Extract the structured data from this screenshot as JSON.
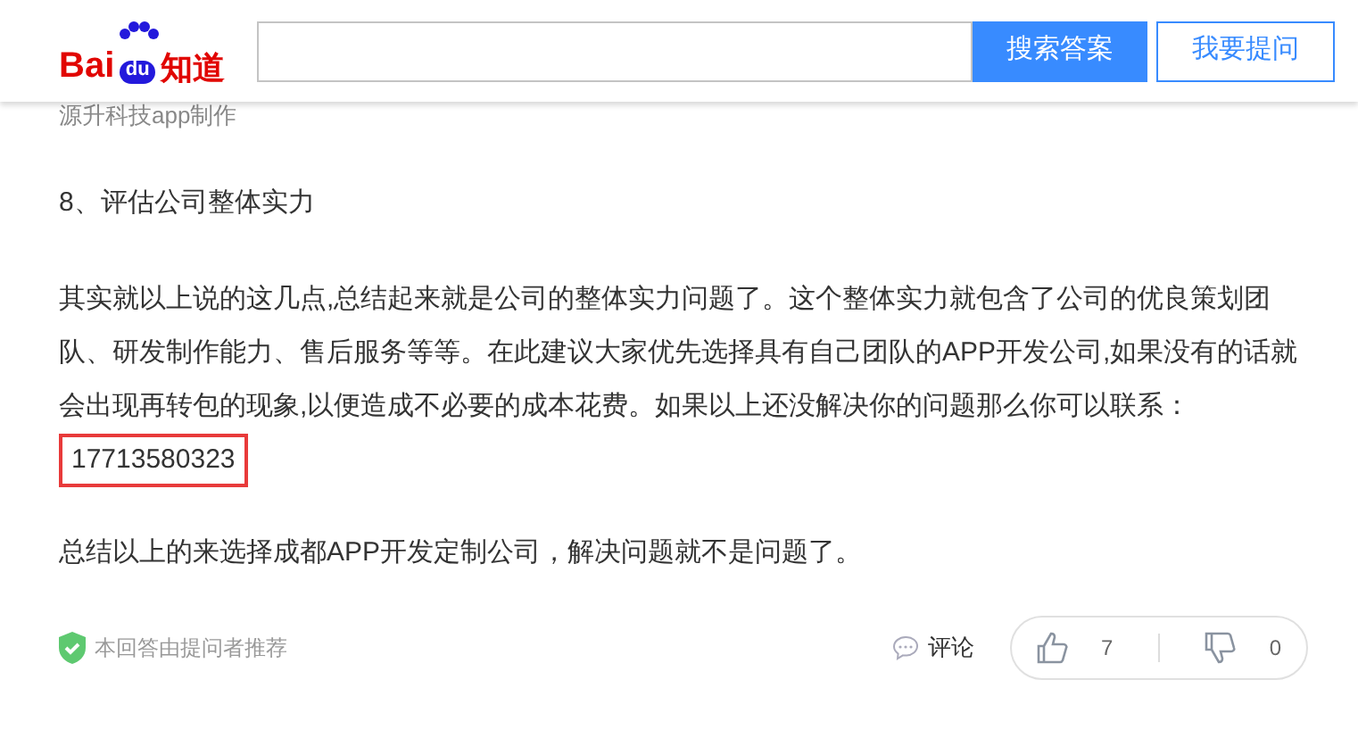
{
  "header": {
    "logo": {
      "left": "Bai",
      "paw": "du",
      "right": "知道"
    },
    "search_button": "搜索答案",
    "ask_button": "我要提问"
  },
  "answer": {
    "cut_line": "源升科技app制作",
    "heading": "8、评估公司整体实力",
    "paragraph": "其实就以上说的这几点,总结起来就是公司的整体实力问题了。这个整体实力就包含了公司的优良策划团队、研发制作能力、售后服务等等。在此建议大家优先选择具有自己团队的APP开发公司,如果没有的话就会出现再转包的现象,以便造成不必要的成本花费。如果以上还没解决你的问题那么你可以联系：",
    "phone": "17713580323",
    "conclusion": "总结以上的来选择成都APP开发定制公司，解决问题就不是问题了。"
  },
  "footer": {
    "recommended": "本回答由提问者推荐",
    "comment": "评论",
    "likes": "7",
    "dislikes": "0"
  }
}
